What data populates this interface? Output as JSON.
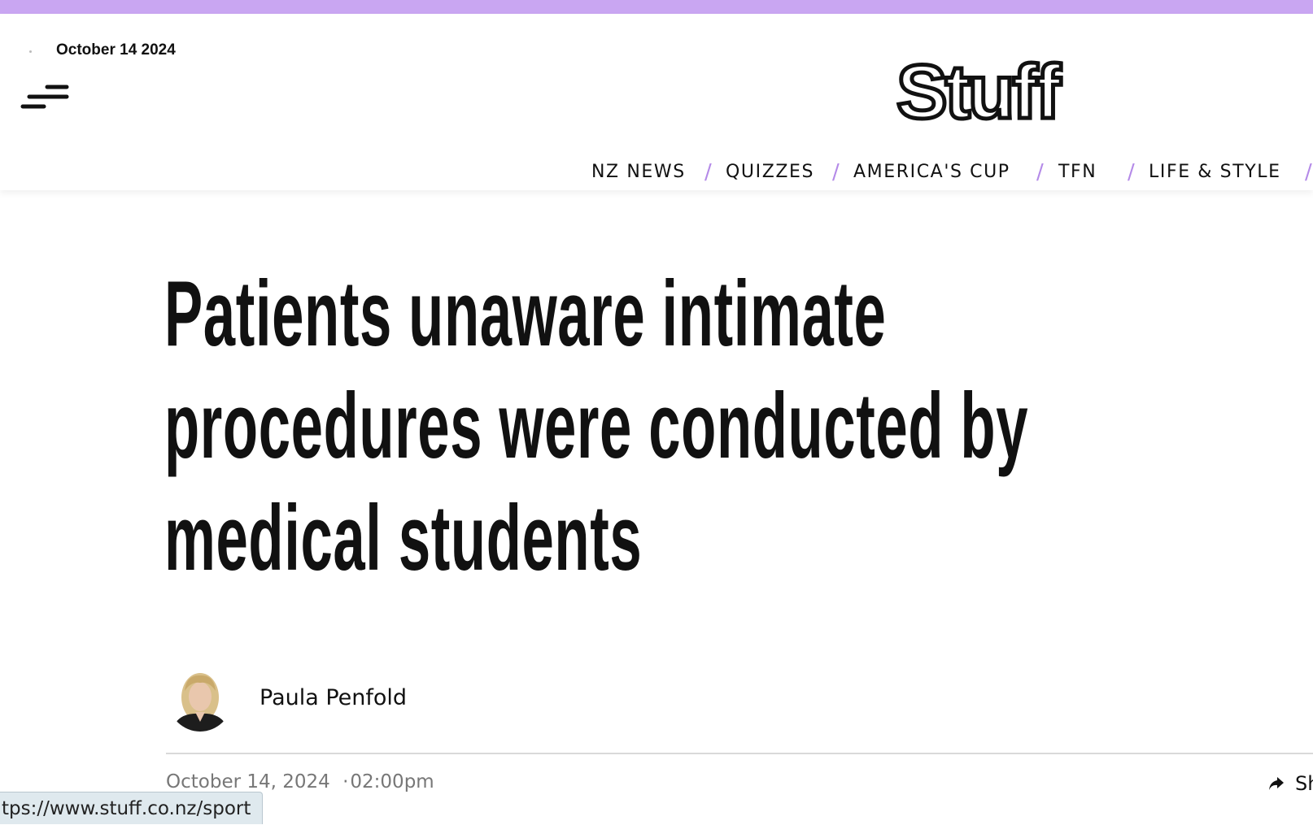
{
  "colors": {
    "accent_bar": "#c9a6f2",
    "nav_separator": "#b48ae8"
  },
  "header": {
    "date": "October 14 2024",
    "logo_text": "Stuff",
    "nav": {
      "separator": "/",
      "items": [
        "NZ NEWS",
        "QUIZZES",
        "AMERICA'S CUP",
        "TFN",
        "LIFE & STYLE"
      ]
    }
  },
  "article": {
    "headline_lines": [
      "Patients unaware intimate",
      "procedures were conducted by",
      "medical students"
    ],
    "author": "Paula Penfold",
    "date": "October 14, 2024",
    "time_separator": "·",
    "time": "02:00pm",
    "share_label": "Sh"
  },
  "icons": {
    "menu": "hamburger-menu-icon",
    "share": "share-arrow-icon"
  },
  "status_bar": {
    "url": "tps://www.stuff.co.nz/sport"
  }
}
